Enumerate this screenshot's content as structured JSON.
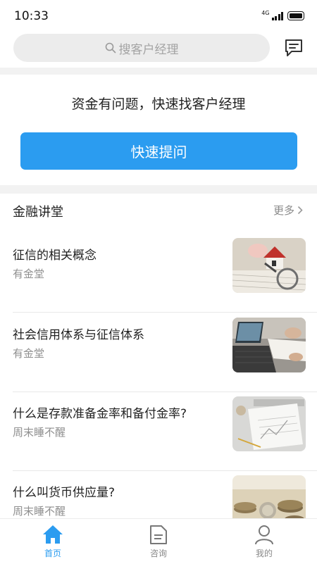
{
  "status_bar": {
    "time": "10:33",
    "network": "4G"
  },
  "search": {
    "placeholder": "搜客户经理"
  },
  "ask": {
    "prompt": "资金有问题，快速找客户经理",
    "button_label": "快速提问"
  },
  "finance_lecture": {
    "title": "金融讲堂",
    "more_label": "更多",
    "articles": [
      {
        "title": "征信的相关概念",
        "author": "有金堂"
      },
      {
        "title": "社会信用体系与征信体系",
        "author": "有金堂"
      },
      {
        "title": "什么是存款准备金率和备付金率?",
        "author": "周末睡不醒"
      },
      {
        "title": "什么叫货币供应量?",
        "author": "周末睡不醒"
      }
    ]
  },
  "tab_bar": {
    "tabs": [
      {
        "label": "首页",
        "icon": "home-icon",
        "active": true
      },
      {
        "label": "咨询",
        "icon": "folder-icon",
        "active": false
      },
      {
        "label": "我的",
        "icon": "user-icon",
        "active": false
      }
    ]
  },
  "colors": {
    "accent": "#2b9cf0",
    "band": "#f2f2f2",
    "muted_text": "#8f8f8f"
  }
}
